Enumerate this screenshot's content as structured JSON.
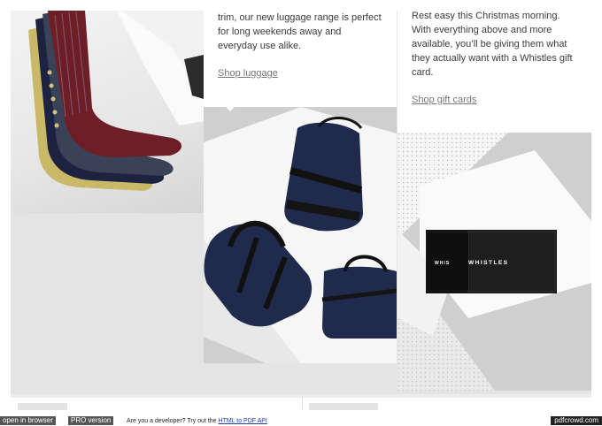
{
  "luggage": {
    "text": "trim, our new luggage range is perfect for long weekends away and everyday use alike.",
    "link": "Shop luggage"
  },
  "gift_cards": {
    "text": "Rest easy this Christmas morning. With everything above and more available, you’ll be giving them what they actually want with a Whistles gift card.",
    "link": "Shop gift cards",
    "card_brand": "WHISTLES",
    "card_brand_short": "WHIS"
  },
  "images": {
    "socks": "socks-photo",
    "bags": "bags-photo",
    "gift_card": "gift-card-box-photo"
  },
  "footer": {
    "open_in_browser": "open in browser",
    "pro_version": "PRO version",
    "developer_prompt": "Are you a developer? Try out the ",
    "api_link": "HTML to PDF API",
    "brand": "pdfcrowd.com"
  },
  "colors": {
    "link": "#777777",
    "navy_bag": "#1f2a4d",
    "card_box": "#141414",
    "footer_button": "#555555"
  }
}
